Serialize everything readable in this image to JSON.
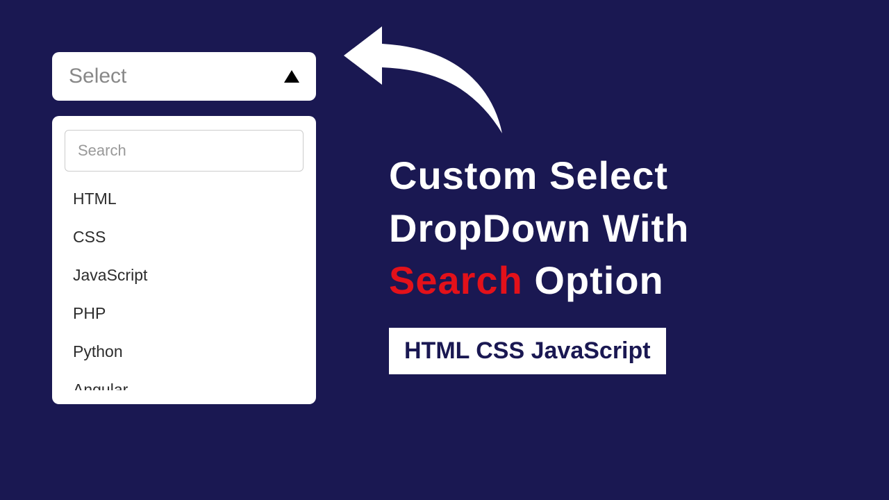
{
  "select": {
    "label": "Select",
    "search_placeholder": "Search",
    "options": [
      "HTML",
      "CSS",
      "JavaScript",
      "PHP",
      "Python",
      "Angular"
    ]
  },
  "title": {
    "line1": "Custom Select",
    "line2": "DropDown With",
    "line3_highlight": "Search",
    "line3_rest": " Option"
  },
  "badge": {
    "text": "HTML CSS JavaScript"
  }
}
